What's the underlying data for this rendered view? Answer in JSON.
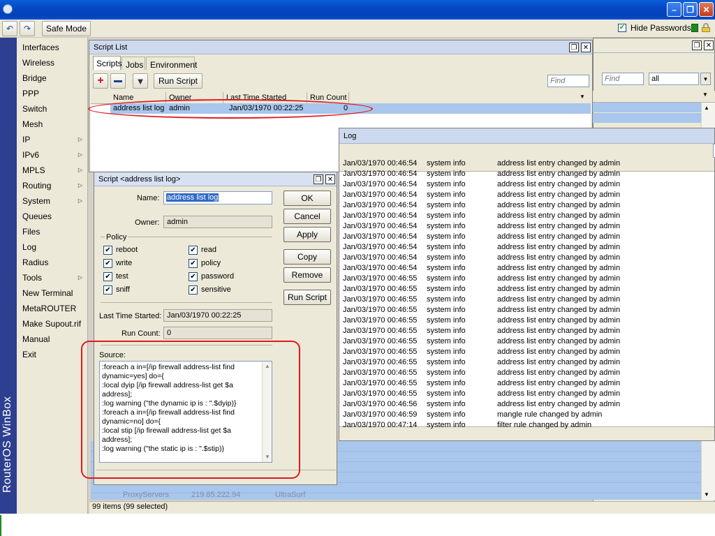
{
  "toolbar": {
    "safe_mode": "Safe Mode",
    "hide_passwords": "Hide Passwords",
    "hide_passwords_checked": true
  },
  "sidebar": {
    "brand": "RouterOS WinBox",
    "items": [
      {
        "label": "Interfaces",
        "submenu": false
      },
      {
        "label": "Wireless",
        "submenu": false
      },
      {
        "label": "Bridge",
        "submenu": false
      },
      {
        "label": "PPP",
        "submenu": false
      },
      {
        "label": "Switch",
        "submenu": false
      },
      {
        "label": "Mesh",
        "submenu": false
      },
      {
        "label": "IP",
        "submenu": true
      },
      {
        "label": "IPv6",
        "submenu": true
      },
      {
        "label": "MPLS",
        "submenu": true
      },
      {
        "label": "Routing",
        "submenu": true
      },
      {
        "label": "System",
        "submenu": true
      },
      {
        "label": "Queues",
        "submenu": false
      },
      {
        "label": "Files",
        "submenu": false
      },
      {
        "label": "Log",
        "submenu": false
      },
      {
        "label": "Radius",
        "submenu": false
      },
      {
        "label": "Tools",
        "submenu": true
      },
      {
        "label": "New Terminal",
        "submenu": false
      },
      {
        "label": "MetaROUTER",
        "submenu": false
      },
      {
        "label": "Make Supout.rif",
        "submenu": false
      },
      {
        "label": "Manual",
        "submenu": false
      },
      {
        "label": "Exit",
        "submenu": false
      }
    ]
  },
  "background_window": {
    "find_placeholder": "Find",
    "filter_value": "all",
    "row_name": "ProxyServers",
    "row_address": "219.85.222.94",
    "row_comment": "UltraSurf",
    "status": "99 items (99 selected)"
  },
  "script_list": {
    "title": "Script List",
    "tabs": [
      "Scripts",
      "Jobs",
      "Environment"
    ],
    "run_script": "Run Script",
    "find_placeholder": "Find",
    "columns": [
      "Name",
      "Owner",
      "Last Time Started",
      "Run Count"
    ],
    "rows": [
      {
        "name": "address list log",
        "owner": "admin",
        "last_started": "Jan/03/1970 00:22:25",
        "run_count": "0"
      }
    ]
  },
  "script_dialog": {
    "title": "Script <address list log>",
    "name_label": "Name:",
    "name_value": "address list log",
    "owner_label": "Owner:",
    "owner_value": "admin",
    "policy_label": "Policy",
    "policies": [
      {
        "label": "reboot",
        "checked": true
      },
      {
        "label": "read",
        "checked": true
      },
      {
        "label": "write",
        "checked": true
      },
      {
        "label": "policy",
        "checked": true
      },
      {
        "label": "test",
        "checked": true
      },
      {
        "label": "password",
        "checked": true
      },
      {
        "label": "sniff",
        "checked": true
      },
      {
        "label": "sensitive",
        "checked": true
      }
    ],
    "last_started_label": "Last Time Started:",
    "last_started_value": "Jan/03/1970 00:22:25",
    "run_count_label": "Run Count:",
    "run_count_value": "0",
    "source_label": "Source:",
    "source_text": ":foreach a in=[/ip firewall address-list find dynamic=yes] do={\n:local dyip [/ip firewall address-list get $a address];\n:log warning (\"the dynamic ip is : \".$dyip)}\n:foreach a in=[/ip firewall address-list find dynamic=no] do={\n:local stip [/ip firewall address-list get $a address];\n:log warning (\"the static ip is : \".$stip)}",
    "buttons": {
      "ok": "OK",
      "cancel": "Cancel",
      "apply": "Apply",
      "copy": "Copy",
      "remove": "Remove",
      "run_script": "Run Script"
    }
  },
  "log_window": {
    "title": "Log",
    "entries": [
      {
        "time": "Jan/03/1970 00:46:54",
        "topic": "system info",
        "message": "address list entry changed by admin"
      },
      {
        "time": "Jan/03/1970 00:46:54",
        "topic": "system info",
        "message": "address list entry changed by admin"
      },
      {
        "time": "Jan/03/1970 00:46:54",
        "topic": "system info",
        "message": "address list entry changed by admin"
      },
      {
        "time": "Jan/03/1970 00:46:54",
        "topic": "system info",
        "message": "address list entry changed by admin"
      },
      {
        "time": "Jan/03/1970 00:46:54",
        "topic": "system info",
        "message": "address list entry changed by admin"
      },
      {
        "time": "Jan/03/1970 00:46:54",
        "topic": "system info",
        "message": "address list entry changed by admin"
      },
      {
        "time": "Jan/03/1970 00:46:54",
        "topic": "system info",
        "message": "address list entry changed by admin"
      },
      {
        "time": "Jan/03/1970 00:46:54",
        "topic": "system info",
        "message": "address list entry changed by admin"
      },
      {
        "time": "Jan/03/1970 00:46:54",
        "topic": "system info",
        "message": "address list entry changed by admin"
      },
      {
        "time": "Jan/03/1970 00:46:54",
        "topic": "system info",
        "message": "address list entry changed by admin"
      },
      {
        "time": "Jan/03/1970 00:46:54",
        "topic": "system info",
        "message": "address list entry changed by admin"
      },
      {
        "time": "Jan/03/1970 00:46:55",
        "topic": "system info",
        "message": "address list entry changed by admin"
      },
      {
        "time": "Jan/03/1970 00:46:55",
        "topic": "system info",
        "message": "address list entry changed by admin"
      },
      {
        "time": "Jan/03/1970 00:46:55",
        "topic": "system info",
        "message": "address list entry changed by admin"
      },
      {
        "time": "Jan/03/1970 00:46:55",
        "topic": "system info",
        "message": "address list entry changed by admin"
      },
      {
        "time": "Jan/03/1970 00:46:55",
        "topic": "system info",
        "message": "address list entry changed by admin"
      },
      {
        "time": "Jan/03/1970 00:46:55",
        "topic": "system info",
        "message": "address list entry changed by admin"
      },
      {
        "time": "Jan/03/1970 00:46:55",
        "topic": "system info",
        "message": "address list entry changed by admin"
      },
      {
        "time": "Jan/03/1970 00:46:55",
        "topic": "system info",
        "message": "address list entry changed by admin"
      },
      {
        "time": "Jan/03/1970 00:46:55",
        "topic": "system info",
        "message": "address list entry changed by admin"
      },
      {
        "time": "Jan/03/1970 00:46:55",
        "topic": "system info",
        "message": "address list entry changed by admin"
      },
      {
        "time": "Jan/03/1970 00:46:55",
        "topic": "system info",
        "message": "address list entry changed by admin"
      },
      {
        "time": "Jan/03/1970 00:46:55",
        "topic": "system info",
        "message": "address list entry changed by admin"
      },
      {
        "time": "Jan/03/1970 00:46:56",
        "topic": "system info",
        "message": "address list entry changed by admin"
      },
      {
        "time": "Jan/03/1970 00:46:59",
        "topic": "system info",
        "message": "mangle rule changed by admin"
      },
      {
        "time": "Jan/03/1970 00:47:14",
        "topic": "system info",
        "message": "filter rule changed by admin"
      }
    ]
  }
}
